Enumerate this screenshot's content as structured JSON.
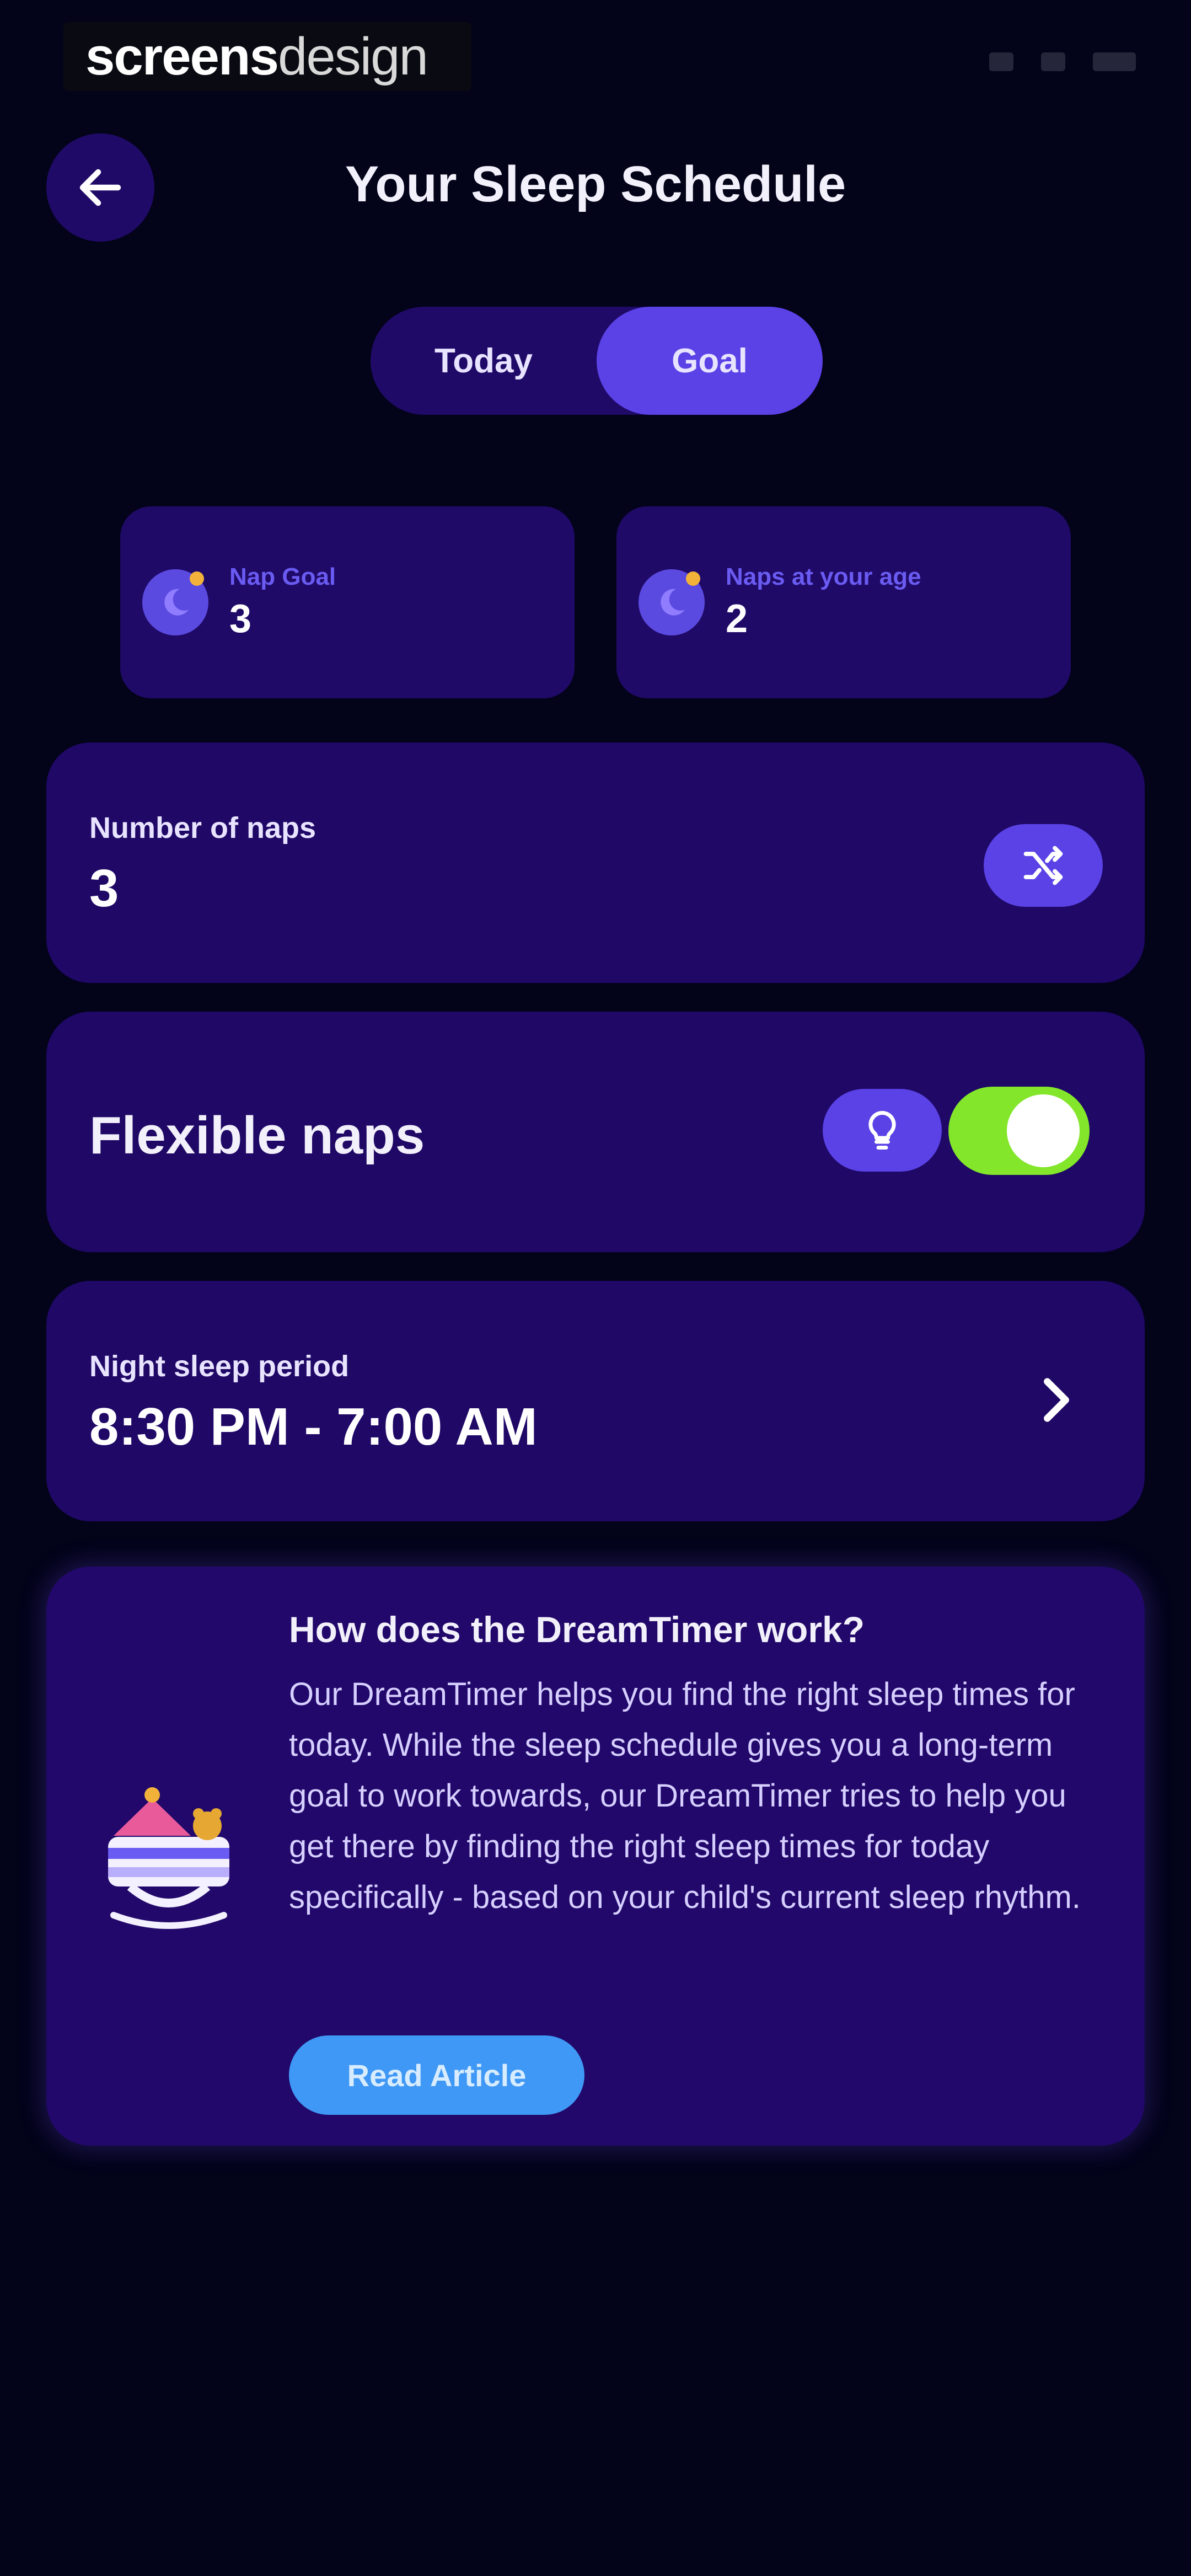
{
  "status_bar": {
    "brand_part1": "screens",
    "brand_part2": "design"
  },
  "header": {
    "title": "Your Sleep Schedule",
    "back_icon": "arrow-left-icon"
  },
  "tabs": [
    {
      "label": "Today",
      "active": false
    },
    {
      "label": "Goal",
      "active": true
    }
  ],
  "info_cards": [
    {
      "label": "Nap Goal",
      "value": "3",
      "icon": "moon-badge-icon"
    },
    {
      "label": "Naps at your age",
      "value": "2",
      "icon": "moon-badge-icon"
    }
  ],
  "naps": {
    "label": "Number of naps",
    "value": "3",
    "icon": "shuffle-icon"
  },
  "flexible": {
    "label": "Flexible naps",
    "toggle_on": true,
    "icon": "lightbulb-icon"
  },
  "night": {
    "label": "Night sleep period",
    "value": "8:30 PM - 7:00 AM",
    "icon": "chevron-right-icon"
  },
  "article": {
    "title": "How does the DreamTimer work?",
    "body": "Our DreamTimer helps you find the right sleep times for today. While the sleep schedule gives you a long-term goal to work towards, our DreamTimer tries to help you get there by finding the right sleep times for today specifically - based on your child's current sleep rhythm.",
    "button_label": "Read Article",
    "illustration": "crib-illustration"
  },
  "colors": {
    "background": "#03031a",
    "card": "#1f0866",
    "accent": "#5a42e6",
    "toggle_on": "#83e62b",
    "button_blue": "#3f98f5"
  }
}
